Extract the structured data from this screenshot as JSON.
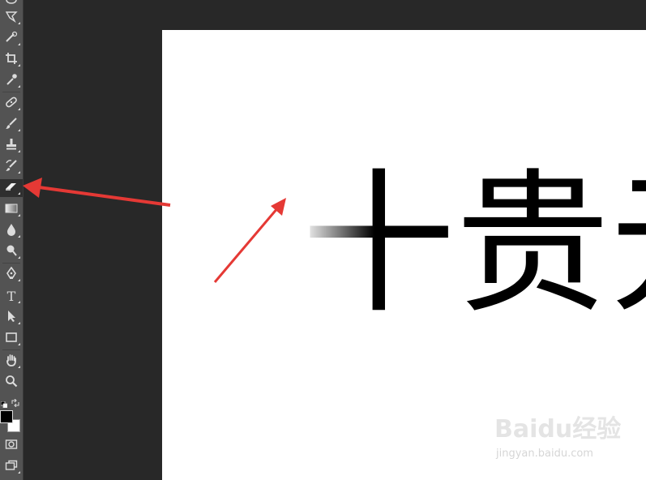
{
  "toolbar": {
    "tools": [
      {
        "name": "lasso-tool",
        "icon": "lasso-icon"
      },
      {
        "name": "polygonal-lasso-tool",
        "icon": "polygonal-lasso-icon"
      },
      {
        "name": "quick-selection-tool",
        "icon": "quick-selection-icon"
      },
      {
        "name": "crop-tool",
        "icon": "crop-icon"
      },
      {
        "name": "eyedropper-tool",
        "icon": "eyedropper-icon"
      },
      {
        "name": "healing-brush-tool",
        "icon": "bandage-icon"
      },
      {
        "name": "brush-tool",
        "icon": "brush-icon"
      },
      {
        "name": "clone-stamp-tool",
        "icon": "stamp-icon"
      },
      {
        "name": "history-brush-tool",
        "icon": "history-brush-icon"
      },
      {
        "name": "eraser-tool",
        "icon": "eraser-icon",
        "active": true
      },
      {
        "name": "gradient-tool",
        "icon": "gradient-icon"
      },
      {
        "name": "blur-tool",
        "icon": "droplet-icon"
      },
      {
        "name": "dodge-tool",
        "icon": "dodge-icon"
      },
      {
        "name": "pen-tool",
        "icon": "pen-icon"
      },
      {
        "name": "type-tool",
        "icon": "type-icon",
        "glyph": "T"
      },
      {
        "name": "path-selection-tool",
        "icon": "arrow-cursor-icon"
      },
      {
        "name": "rectangle-tool",
        "icon": "rectangle-icon"
      },
      {
        "name": "hand-tool",
        "icon": "hand-icon"
      },
      {
        "name": "zoom-tool",
        "icon": "magnifier-icon"
      }
    ],
    "foreground_color": "#000000",
    "background_color": "#ffffff"
  },
  "canvas": {
    "text": "十贵元",
    "background": "#ffffff"
  },
  "watermark": {
    "logo": "Baidu经验",
    "url": "jingyan.baidu.com"
  },
  "annotation": {
    "arrow_color": "#e53935"
  }
}
